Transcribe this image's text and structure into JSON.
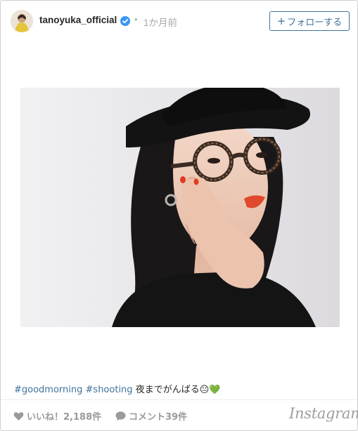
{
  "post": {
    "username": "tanoyuka_official",
    "separator": "•",
    "time": "1か月前",
    "follow_label": "フォローする",
    "follow_plus": "+"
  },
  "caption": {
    "hashtags": [
      "#goodmorning",
      "#shooting"
    ],
    "text": "夜までがんばる😐💚"
  },
  "footer": {
    "likes_label": "いいね！2,188件",
    "comments_label": "コメント39件",
    "brand": "Instagram"
  },
  "icons": {
    "verified": "verified-badge-icon",
    "like": "heart-icon",
    "comment": "speech-bubble-icon"
  },
  "colors": {
    "link": "#3f729b",
    "muted": "#9a9a9a",
    "verified": "#3897f0"
  }
}
